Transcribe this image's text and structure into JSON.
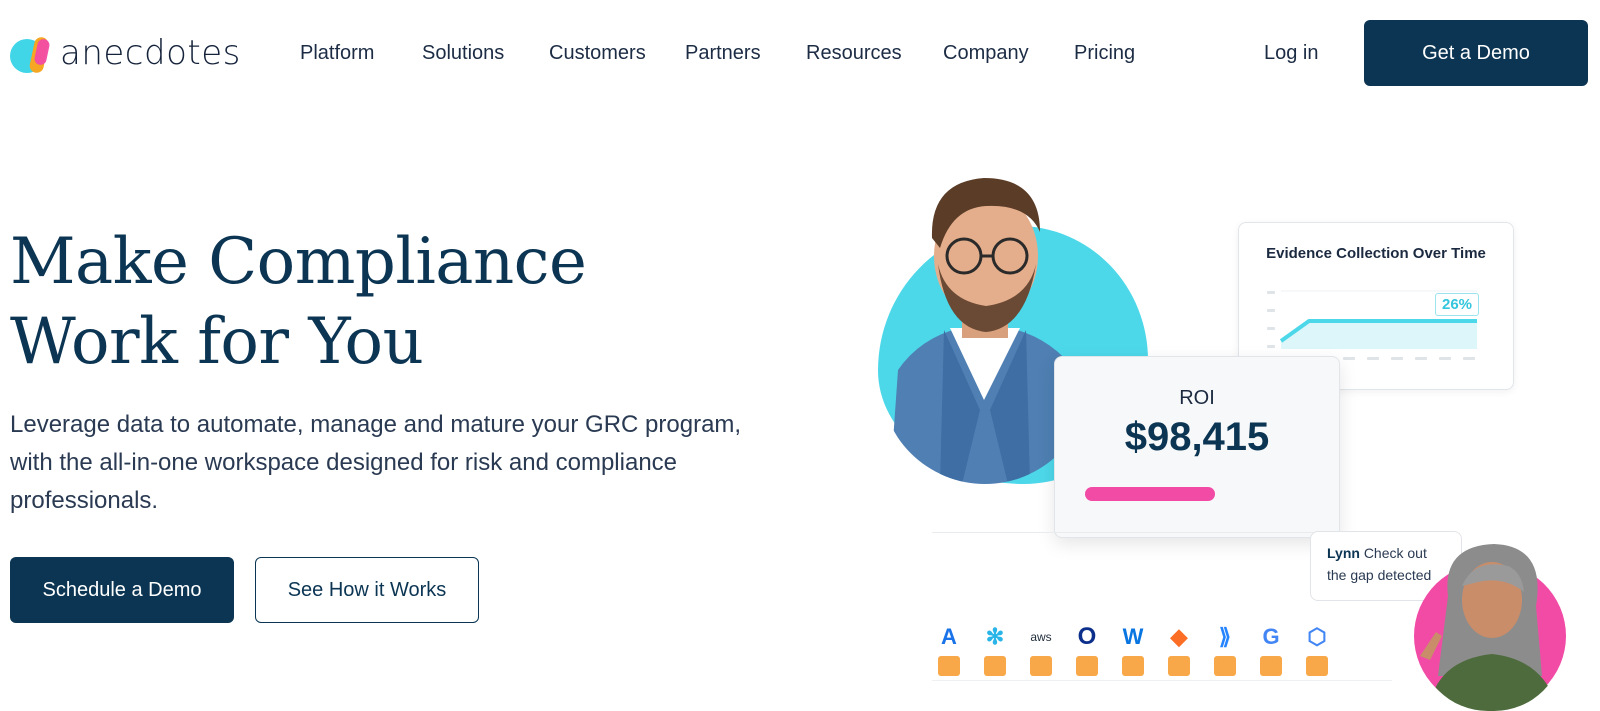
{
  "brand": {
    "logo_text": "anecdotes",
    "colors": {
      "navy": "#0b3553",
      "cyan": "#4dd8ea",
      "pink": "#f24ba6",
      "orange": "#f8a848"
    }
  },
  "nav": {
    "items": [
      "Platform",
      "Solutions",
      "Customers",
      "Partners",
      "Resources",
      "Company",
      "Pricing"
    ],
    "login": "Log in",
    "cta": "Get a Demo"
  },
  "hero": {
    "title_line1": "Make Compliance",
    "title_line2": "Work for You",
    "subtitle": "Leverage data to automate, manage and mature your GRC program, with the all-in-one workspace designed for risk and compliance professionals.",
    "primary_button": "Schedule a Demo",
    "secondary_button": "See How it Works"
  },
  "illustration": {
    "chart_card": {
      "title": "Evidence Collection Over Time",
      "badge": "26%"
    },
    "roi_card": {
      "label": "ROI",
      "value": "$98,415"
    },
    "message": {
      "name": "Lynn",
      "text": "Check out the gap detected"
    },
    "integrations": [
      {
        "icon": "azure-icon",
        "glyph": "A",
        "color": "#1a73e8"
      },
      {
        "icon": "snowflake-icon",
        "glyph": "✻",
        "color": "#29b5e8"
      },
      {
        "icon": "aws-icon",
        "glyph": "aws",
        "color": "#232f3e"
      },
      {
        "icon": "okta-icon",
        "glyph": "O",
        "color": "#0b2f8a"
      },
      {
        "icon": "workday-icon",
        "glyph": "W",
        "color": "#0875e1"
      },
      {
        "icon": "gitlab-icon",
        "glyph": "◆",
        "color": "#fc6d26"
      },
      {
        "icon": "jira-icon",
        "glyph": "⟫",
        "color": "#2684ff"
      },
      {
        "icon": "google-icon",
        "glyph": "G",
        "color": "#4285f4"
      },
      {
        "icon": "gcp-icon",
        "glyph": "⬡",
        "color": "#4285f4"
      }
    ]
  }
}
